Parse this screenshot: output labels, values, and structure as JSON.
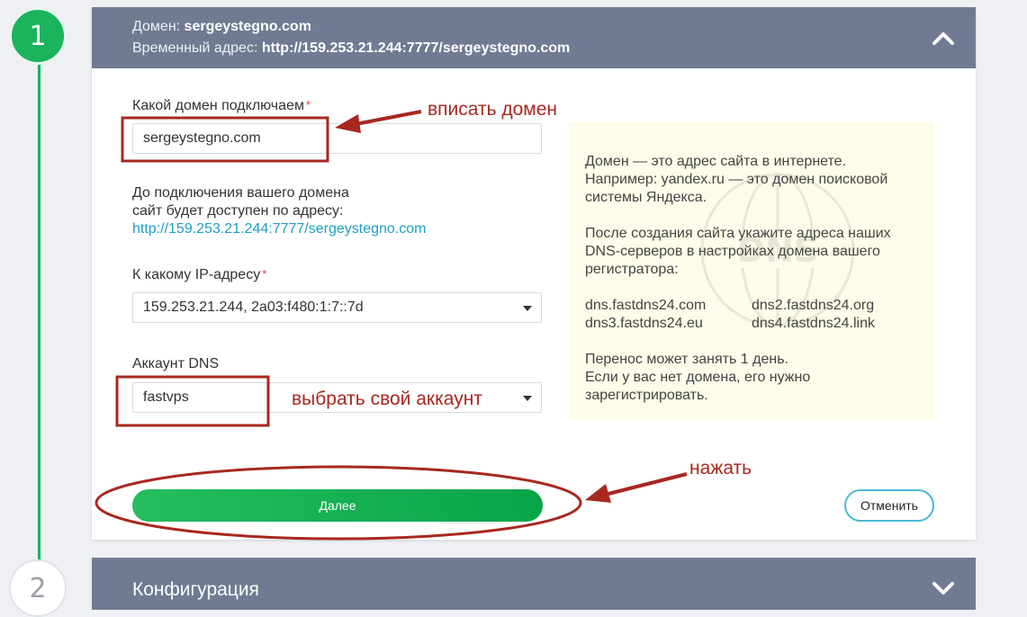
{
  "stepper": {
    "step1_number": "1",
    "step2_number": "2"
  },
  "domain_section": {
    "header_domain_label": "Домен:",
    "header_domain_value": "sergeystegno.com",
    "header_temp_label": "Временный адрес:",
    "header_temp_value": "http://159.253.21.244:7777/sergeystegno.com",
    "domain_field_label": "Какой домен подключаем",
    "domain_field_value": "sergeystegno.com",
    "required_mark": "*",
    "note_line1": "До подключения вашего домена",
    "note_line2": "сайт будет доступен по адресу:",
    "note_link": "http://159.253.21.244:7777/sergeystegno.com",
    "ip_label": "К какому IP-адресу",
    "ip_selected": "159.253.21.244, 2a03:f480:1:7::7d",
    "dns_label": "Аккаунт DNS",
    "dns_selected": "fastvps",
    "next_button": "Далее",
    "cancel_button": "Отменить"
  },
  "info_box": {
    "p1_line1": "Домен — это адрес сайта в интернете.",
    "p1_line2": "Например: yandex.ru — это домен поисковой",
    "p1_line3": "системы Яндекса.",
    "p2_line1": "После создания сайта укажите адреса наших",
    "p2_line2": "DNS-серверов в настройках домена вашего",
    "p2_line3": "регистратора:",
    "dns_servers": [
      "dns.fastdns24.com",
      "dns2.fastdns24.org",
      "dns3.fastdns24.eu",
      "dns4.fastdns24.link"
    ],
    "p3_line1": "Перенос может занять 1 день.",
    "p3_line2": "Если у вас нет домена, его нужно",
    "p3_line3": "зарегистрировать.",
    "watermark_text": "DNS"
  },
  "config_section": {
    "title": "Конфигурация"
  },
  "annotations": {
    "enter_domain": "вписать домен",
    "choose_account": "выбрать свой аккаунт",
    "press": "нажать",
    "color": "#a8281f"
  },
  "colors": {
    "header_bg": "#707b93",
    "step_green": "#1bb35b",
    "link": "#1d9fc3",
    "info_bg": "#fdfbe9",
    "cancel_border": "#4bb8d3"
  }
}
